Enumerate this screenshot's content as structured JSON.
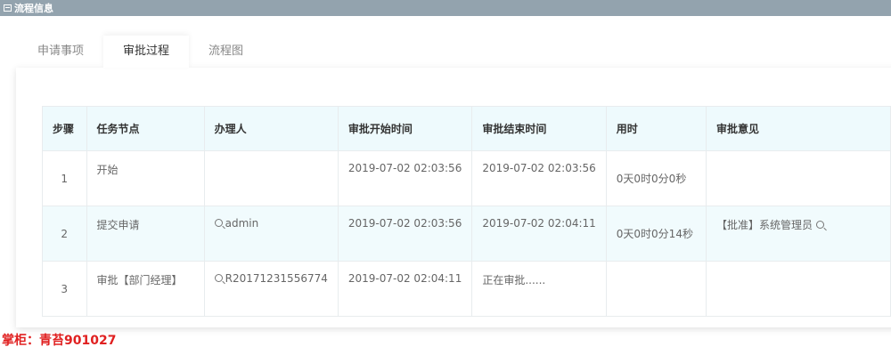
{
  "title": "流程信息",
  "tabs": [
    "申请事项",
    "审批过程",
    "流程图"
  ],
  "table": {
    "headers": [
      "步骤",
      "任务节点",
      "办理人",
      "审批开始时间",
      "审批结束时间",
      "用时",
      "审批意见"
    ],
    "rows": [
      {
        "step": "1",
        "node": "开始",
        "handler": "",
        "start": "2019-07-02 02:03:56",
        "end": "2019-07-02 02:03:56",
        "duration": "0天0时0分0秒",
        "opinion": ""
      },
      {
        "step": "2",
        "node": "提交申请",
        "handler": "admin",
        "start": "2019-07-02 02:03:56",
        "end": "2019-07-02 02:04:11",
        "duration": "0天0时0分14秒",
        "opinion": "【批准】系统管理员"
      },
      {
        "step": "3",
        "node": "审批【部门经理】",
        "handler": "R20171231556774",
        "start": "2019-07-02 02:04:11",
        "end": "正在审批......",
        "duration": "",
        "opinion": ""
      }
    ]
  },
  "signature": "掌柜：青苔901027"
}
